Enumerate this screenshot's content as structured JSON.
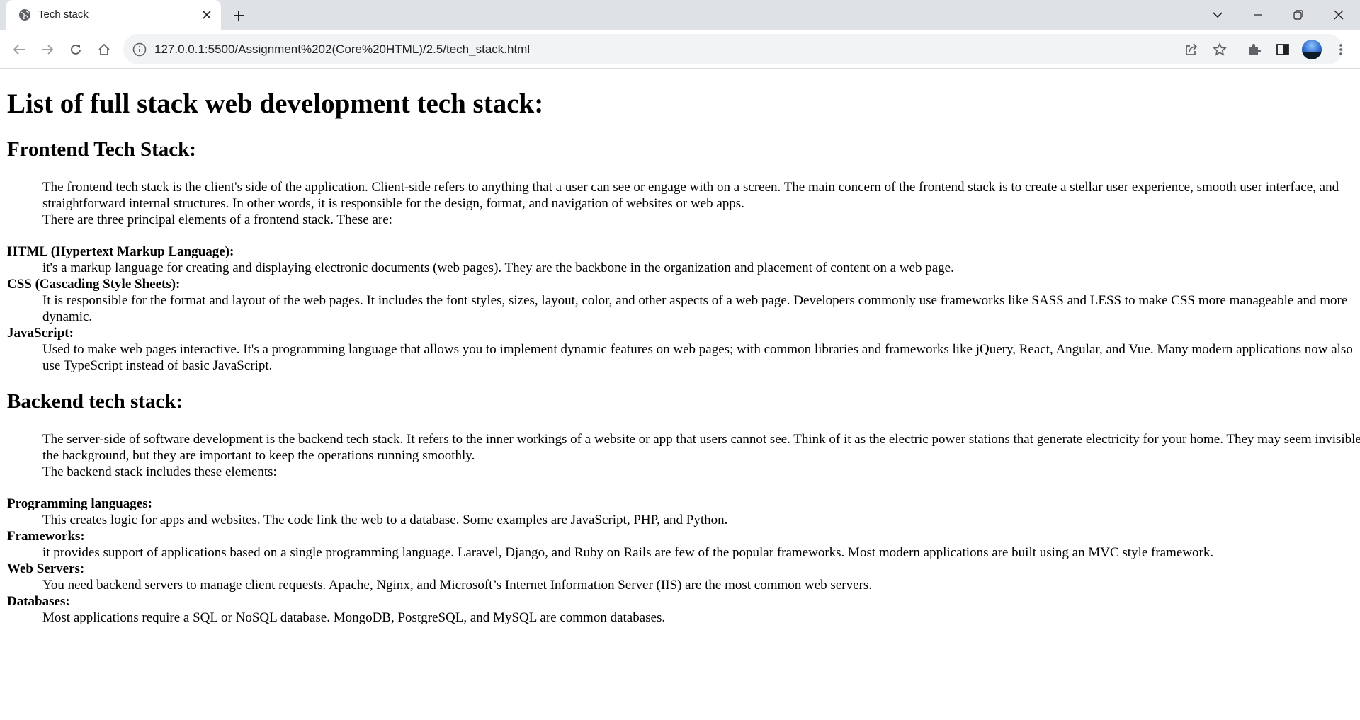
{
  "browser": {
    "tab": {
      "title": "Tech stack"
    },
    "url": "127.0.0.1:5500/Assignment%202(Core%20HTML)/2.5/tech_stack.html"
  },
  "page": {
    "title": "List of full stack web development tech stack:",
    "frontend": {
      "heading": "Frontend Tech Stack:",
      "intro": "The frontend tech stack is the client's side of the application. Client-side refers to anything that a user can see or engage with on a screen. The main concern of the frontend stack is to create a stellar user experience, smooth user interface, and straightforward internal structures. In other words, it is responsible for the design, format, and navigation of websites or web apps.",
      "intro2": "There are three principal elements of a frontend stack. These are:",
      "items": [
        {
          "term": "HTML (Hypertext Markup Language):",
          "desc": "it's a markup language for creating and displaying electronic documents (web pages). They are the backbone in the organization and placement of content on a web page."
        },
        {
          "term": "CSS (Cascading Style Sheets):",
          "desc": "It is responsible for the format and layout of the web pages. It includes the font styles, sizes, layout, color, and other aspects of a web page. Developers commonly use frameworks like SASS and LESS to make CSS more manageable and more dynamic."
        },
        {
          "term": "JavaScript:",
          "desc": "Used to make web pages interactive. It's a programming language that allows you to implement dynamic features on web pages; with common libraries and frameworks like jQuery, React, Angular, and Vue. Many modern applications now also use TypeScript instead of basic JavaScript."
        }
      ]
    },
    "backend": {
      "heading": "Backend tech stack:",
      "intro": "The server-side of software development is the backend tech stack. It refers to the inner workings of a website or app that users cannot see. Think of it as the electric power stations that generate electricity for your home. They may seem invisible in the background, but they are important to keep the operations running smoothly.",
      "intro2": "The backend stack includes these elements:",
      "items": [
        {
          "term": "Programming languages:",
          "desc": "This creates logic for apps and websites. The code link the web to a database. Some examples are JavaScript, PHP, and Python."
        },
        {
          "term": "Frameworks:",
          "desc": "it provides support of applications based on a single programming language. Laravel, Django, and Ruby on Rails are few of the popular frameworks. Most modern applications are built using an MVC style framework."
        },
        {
          "term": "Web Servers:",
          "desc": "You need backend servers to manage client requests. Apache, Nginx, and Microsoft’s Internet Information Server (IIS) are the most common web servers."
        },
        {
          "term": "Databases:",
          "desc": "Most applications require a SQL or NoSQL database. MongoDB, PostgreSQL, and MySQL are common databases."
        }
      ]
    }
  }
}
